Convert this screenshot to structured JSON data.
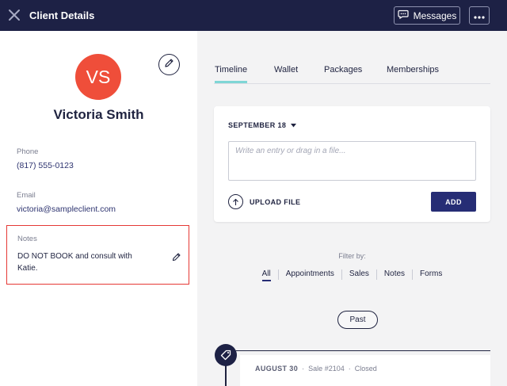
{
  "header": {
    "title": "Client Details",
    "messages_label": "Messages",
    "close_icon": "close-icon",
    "more_icon": "ellipsis-icon"
  },
  "client": {
    "initials": "VS",
    "name": "Victoria Smith",
    "phone_label": "Phone",
    "phone": "(817) 555-0123",
    "email_label": "Email",
    "email": "victoria@sampleclient.com",
    "notes_label": "Notes",
    "notes": "DO NOT BOOK and consult with Katie."
  },
  "tabs": [
    {
      "label": "Timeline",
      "active": true
    },
    {
      "label": "Wallet",
      "active": false
    },
    {
      "label": "Packages",
      "active": false
    },
    {
      "label": "Memberships",
      "active": false
    }
  ],
  "entry": {
    "date": "SEPTEMBER 18",
    "placeholder": "Write an entry or drag in a file...",
    "upload_label": "UPLOAD FILE",
    "add_label": "ADD"
  },
  "filter": {
    "label": "Filter by:",
    "items": [
      {
        "label": "All",
        "active": true
      },
      {
        "label": "Appointments",
        "active": false
      },
      {
        "label": "Sales",
        "active": false
      },
      {
        "label": "Notes",
        "active": false
      },
      {
        "label": "Forms",
        "active": false
      }
    ]
  },
  "past_label": "Past",
  "timeline": [
    {
      "date": "AUGUST 30",
      "type": "Sale",
      "number": "#2104",
      "status": "Closed"
    }
  ],
  "colors": {
    "header_bg": "#1d2145",
    "avatar_bg": "#ef4e3a",
    "accent": "#262d75",
    "tab_underline": "#7fd6d6",
    "notes_highlight": "#e53935"
  }
}
